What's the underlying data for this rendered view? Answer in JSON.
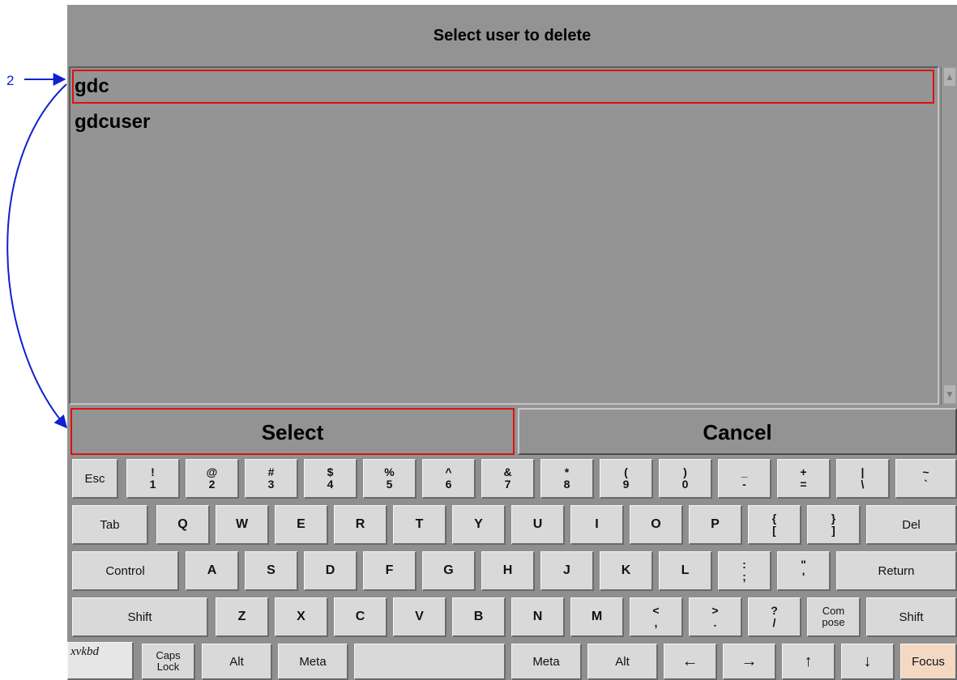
{
  "dialog": {
    "title": "Select user to delete",
    "users": [
      "gdc",
      "gdcuser"
    ],
    "select_label": "Select",
    "cancel_label": "Cancel"
  },
  "annotation": {
    "step_label": "2",
    "color": "#1020d0"
  },
  "highlight_color": "#e01010",
  "keyboard": {
    "esc": "Esc",
    "number_keys": [
      {
        "top": "!",
        "bottom": "1"
      },
      {
        "top": "@",
        "bottom": "2"
      },
      {
        "top": "#",
        "bottom": "3"
      },
      {
        "top": "$",
        "bottom": "4"
      },
      {
        "top": "%",
        "bottom": "5"
      },
      {
        "top": "^",
        "bottom": "6"
      },
      {
        "top": "&",
        "bottom": "7"
      },
      {
        "top": "*",
        "bottom": "8"
      },
      {
        "top": "(",
        "bottom": "9"
      },
      {
        "top": ")",
        "bottom": "0"
      },
      {
        "top": "_",
        "bottom": "-"
      },
      {
        "top": "+",
        "bottom": "="
      },
      {
        "top": "|",
        "bottom": "\\"
      },
      {
        "top": "~",
        "bottom": "`"
      }
    ],
    "tab": "Tab",
    "row_q": [
      "Q",
      "W",
      "E",
      "R",
      "T",
      "Y",
      "U",
      "I",
      "O",
      "P"
    ],
    "brace_keys": [
      {
        "top": "{",
        "bottom": "["
      },
      {
        "top": "}",
        "bottom": "]"
      }
    ],
    "del": "Del",
    "control": "Control",
    "row_a": [
      "A",
      "S",
      "D",
      "F",
      "G",
      "H",
      "J",
      "K",
      "L"
    ],
    "colon_keys": [
      {
        "top": ":",
        "bottom": ";"
      },
      {
        "top": "\"",
        "bottom": "'"
      }
    ],
    "return": "Return",
    "shift": "Shift",
    "row_z": [
      "Z",
      "X",
      "C",
      "V",
      "B",
      "N",
      "M"
    ],
    "punct_keys": [
      {
        "top": "<",
        "bottom": ","
      },
      {
        "top": ">",
        "bottom": "."
      },
      {
        "top": "?",
        "bottom": "/"
      }
    ],
    "compose": {
      "top": "Com",
      "bottom": "pose"
    },
    "logo": "xvkbd",
    "caps_lock": {
      "top": "Caps",
      "bottom": "Lock"
    },
    "alt": "Alt",
    "meta": "Meta",
    "arrow_left": "←",
    "arrow_right": "→",
    "arrow_up": "↑",
    "arrow_down": "↓",
    "focus": "Focus"
  }
}
